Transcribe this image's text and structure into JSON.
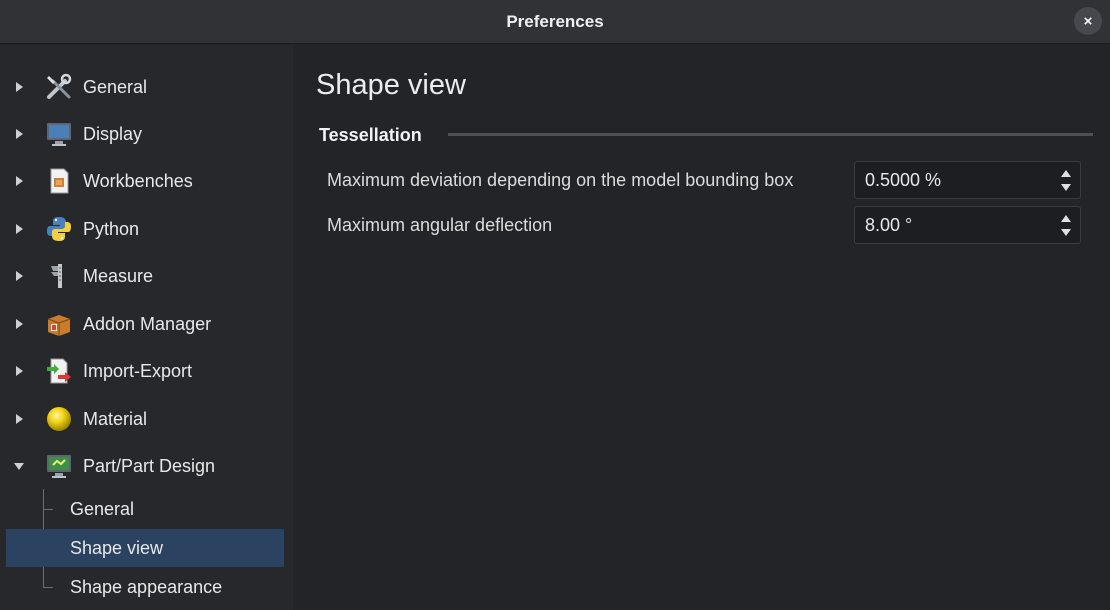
{
  "window": {
    "title": "Preferences",
    "close_symbol": "×"
  },
  "sidebar": {
    "items": [
      {
        "label": "General",
        "icon": "tools-icon",
        "expanded": false
      },
      {
        "label": "Display",
        "icon": "monitor-icon",
        "expanded": false
      },
      {
        "label": "Workbenches",
        "icon": "workbench-icon",
        "expanded": false
      },
      {
        "label": "Python",
        "icon": "python-icon",
        "expanded": false
      },
      {
        "label": "Measure",
        "icon": "caliper-icon",
        "expanded": false
      },
      {
        "label": "Addon Manager",
        "icon": "addon-box-icon",
        "expanded": false
      },
      {
        "label": "Import-Export",
        "icon": "import-export-icon",
        "expanded": false
      },
      {
        "label": "Material",
        "icon": "material-sphere-icon",
        "expanded": false
      },
      {
        "label": "Part/Part Design",
        "icon": "part-design-icon",
        "expanded": true
      }
    ],
    "children": [
      {
        "label": "General",
        "selected": false
      },
      {
        "label": "Shape view",
        "selected": true
      },
      {
        "label": "Shape appearance",
        "selected": false
      }
    ]
  },
  "main": {
    "page_title": "Shape view",
    "group_title": "Tessellation",
    "rows": [
      {
        "label": "Maximum deviation depending on the model bounding box",
        "value": "0.5000 %"
      },
      {
        "label": "Maximum angular deflection",
        "value": "8.00 °"
      }
    ]
  },
  "colors": {
    "selection": "#2b4260",
    "background": "#222428",
    "sidebar": "#26282c"
  }
}
